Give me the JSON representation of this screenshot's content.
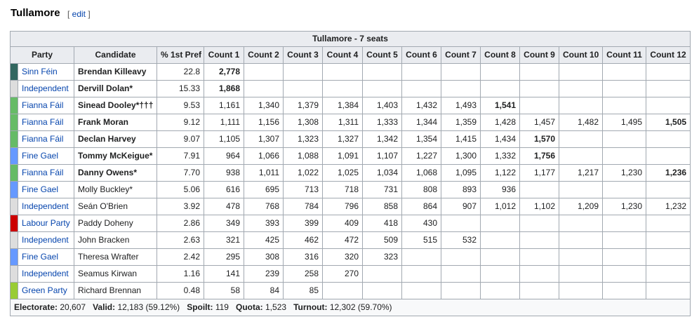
{
  "section": {
    "title": "Tullamore",
    "edit_label": "edit"
  },
  "colors": {
    "Sinn Féin": "#326760",
    "Independent": "#dddddd",
    "Fianna Fáil": "#66bb66",
    "Fine Gael": "#6699ff",
    "Labour Party": "#cc0000",
    "Green Party": "#99cc33"
  },
  "table": {
    "caption": "Tullamore - 7 seats",
    "headers": [
      "Party",
      "Candidate",
      "% 1st Pref",
      "Count 1",
      "Count 2",
      "Count 3",
      "Count 4",
      "Count 5",
      "Count 6",
      "Count 7",
      "Count 8",
      "Count 9",
      "Count 10",
      "Count 11",
      "Count 12"
    ],
    "rows": [
      {
        "party": "Sinn Féin",
        "candidate": "Brendan Killeavy",
        "elected": true,
        "pct": "22.8",
        "counts": [
          "2,778",
          "",
          "",
          "",
          "",
          "",
          "",
          "",
          "",
          "",
          "",
          ""
        ],
        "bold_count": 0
      },
      {
        "party": "Independent",
        "candidate": "Dervill Dolan*",
        "elected": true,
        "pct": "15.33",
        "counts": [
          "1,868",
          "",
          "",
          "",
          "",
          "",
          "",
          "",
          "",
          "",
          "",
          ""
        ],
        "bold_count": 0
      },
      {
        "party": "Fianna Fáil",
        "candidate": "Sinead Dooley*†††",
        "elected": true,
        "pct": "9.53",
        "counts": [
          "1,161",
          "1,340",
          "1,379",
          "1,384",
          "1,403",
          "1,432",
          "1,493",
          "1,541",
          "",
          "",
          "",
          ""
        ],
        "bold_count": 7
      },
      {
        "party": "Fianna Fáil",
        "candidate": "Frank Moran",
        "elected": true,
        "pct": "9.12",
        "counts": [
          "1,111",
          "1,156",
          "1,308",
          "1,311",
          "1,333",
          "1,344",
          "1,359",
          "1,428",
          "1,457",
          "1,482",
          "1,495",
          "1,505"
        ],
        "bold_count": 11
      },
      {
        "party": "Fianna Fáil",
        "candidate": "Declan Harvey",
        "elected": true,
        "pct": "9.07",
        "counts": [
          "1,105",
          "1,307",
          "1,323",
          "1,327",
          "1,342",
          "1,354",
          "1,415",
          "1,434",
          "1,570",
          "",
          "",
          ""
        ],
        "bold_count": 8
      },
      {
        "party": "Fine Gael",
        "candidate": "Tommy McKeigue*",
        "elected": true,
        "pct": "7.91",
        "counts": [
          "964",
          "1,066",
          "1,088",
          "1,091",
          "1,107",
          "1,227",
          "1,300",
          "1,332",
          "1,756",
          "",
          "",
          ""
        ],
        "bold_count": 8
      },
      {
        "party": "Fianna Fáil",
        "candidate": "Danny Owens*",
        "elected": true,
        "pct": "7.70",
        "counts": [
          "938",
          "1,011",
          "1,022",
          "1,025",
          "1,034",
          "1,068",
          "1,095",
          "1,122",
          "1,177",
          "1,217",
          "1,230",
          "1,236"
        ],
        "bold_count": 11
      },
      {
        "party": "Fine Gael",
        "candidate": "Molly Buckley*",
        "elected": false,
        "pct": "5.06",
        "counts": [
          "616",
          "695",
          "713",
          "718",
          "731",
          "808",
          "893",
          "936",
          "",
          "",
          "",
          ""
        ],
        "bold_count": -1
      },
      {
        "party": "Independent",
        "candidate": "Seán O'Brien",
        "elected": false,
        "pct": "3.92",
        "counts": [
          "478",
          "768",
          "784",
          "796",
          "858",
          "864",
          "907",
          "1,012",
          "1,102",
          "1,209",
          "1,230",
          "1,232"
        ],
        "bold_count": -1
      },
      {
        "party": "Labour Party",
        "candidate": "Paddy Doheny",
        "elected": false,
        "pct": "2.86",
        "counts": [
          "349",
          "393",
          "399",
          "409",
          "418",
          "430",
          "",
          "",
          "",
          "",
          "",
          ""
        ],
        "bold_count": -1
      },
      {
        "party": "Independent",
        "candidate": "John Bracken",
        "elected": false,
        "pct": "2.63",
        "counts": [
          "321",
          "425",
          "462",
          "472",
          "509",
          "515",
          "532",
          "",
          "",
          "",
          "",
          ""
        ],
        "bold_count": -1
      },
      {
        "party": "Fine Gael",
        "candidate": "Theresa Wrafter",
        "elected": false,
        "pct": "2.42",
        "counts": [
          "295",
          "308",
          "316",
          "320",
          "323",
          "",
          "",
          "",
          "",
          "",
          "",
          ""
        ],
        "bold_count": -1
      },
      {
        "party": "Independent",
        "candidate": "Seamus Kirwan",
        "elected": false,
        "pct": "1.16",
        "counts": [
          "141",
          "239",
          "258",
          "270",
          "",
          "",
          "",
          "",
          "",
          "",
          "",
          ""
        ],
        "bold_count": -1
      },
      {
        "party": "Green Party",
        "candidate": "Richard Brennan",
        "elected": false,
        "pct": "0.48",
        "counts": [
          "58",
          "84",
          "85",
          "",
          "",
          "",
          "",
          "",
          "",
          "",
          "",
          ""
        ],
        "bold_count": -1
      }
    ],
    "footer": [
      {
        "label": "Electorate:",
        "value": "20,607"
      },
      {
        "label": "Valid:",
        "value": "12,183 (59.12%)"
      },
      {
        "label": "Spoilt:",
        "value": "119"
      },
      {
        "label": "Quota:",
        "value": "1,523"
      },
      {
        "label": "Turnout:",
        "value": "12,302 (59.70%)"
      }
    ]
  }
}
